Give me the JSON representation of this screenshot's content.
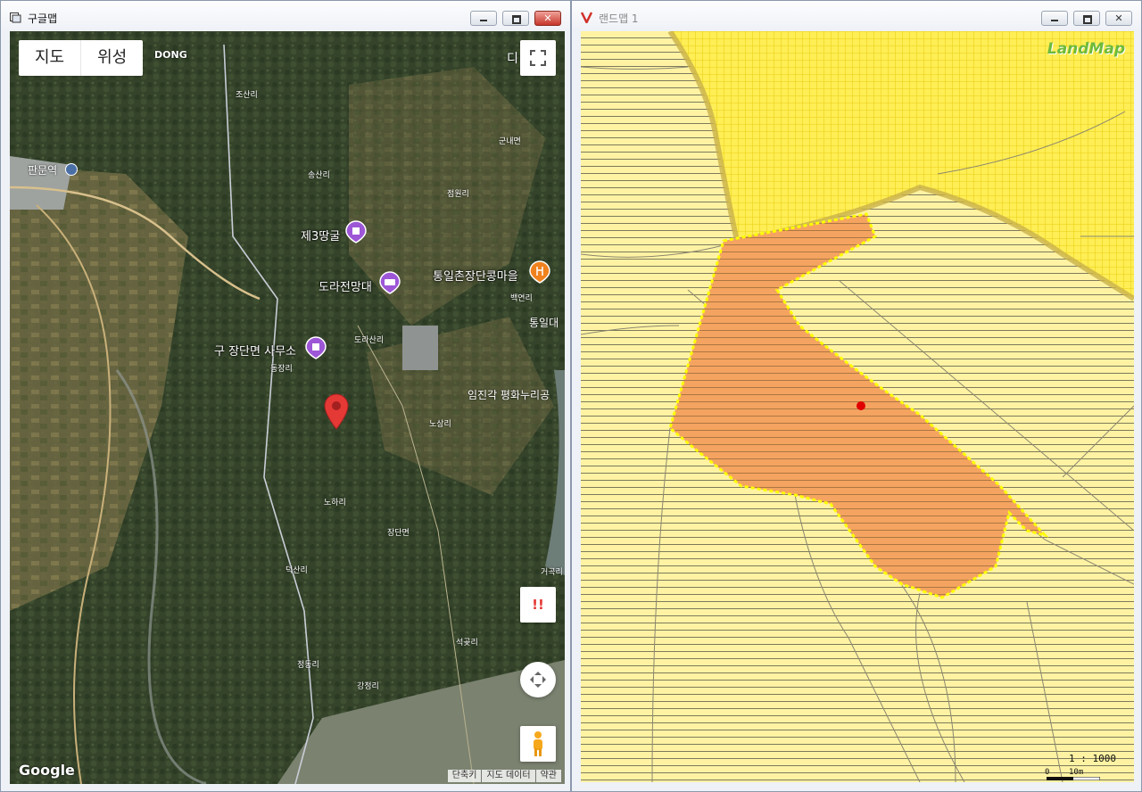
{
  "google_window": {
    "title": "구글맵",
    "map_type": {
      "map_label": "지도",
      "satellite_label": "위성"
    },
    "corner_text": {
      "top_left": "DONG",
      "top_right": "디"
    },
    "pois": [
      {
        "label": "제3땅굴",
        "color": "#9c56d6"
      },
      {
        "label": "도라전망대",
        "color": "#9c56d6"
      },
      {
        "label": "구 장단면 사무소",
        "color": "#9c56d6"
      },
      {
        "label": "통일촌장단콩마을",
        "color": "#f0821e"
      }
    ],
    "places": [
      "조산리",
      "판문역",
      "송산리",
      "군내면",
      "점원리",
      "백연리",
      "통일대",
      "도라산리",
      "동장리",
      "임진각 평화누리공",
      "노상리",
      "노하리",
      "장단면",
      "덕산리",
      "거곡리",
      "석곶리",
      "정동리",
      "강정리"
    ],
    "logo": "Google",
    "footer": {
      "shortcuts": "단축키",
      "map_data": "지도 데이터",
      "terms": "약관"
    },
    "report_symbol": "!!",
    "marker_color": "#e53935"
  },
  "land_window": {
    "title": "랜드맵 1",
    "logo": "LandMap",
    "scale_text": "1 : 1000",
    "scale_zero": "0",
    "scale_ten": "10m",
    "colors": {
      "parcel_fill": "#f4a460",
      "parcel_border": "#ffff00",
      "background": "#fff3a3",
      "point": "#e00000"
    }
  }
}
